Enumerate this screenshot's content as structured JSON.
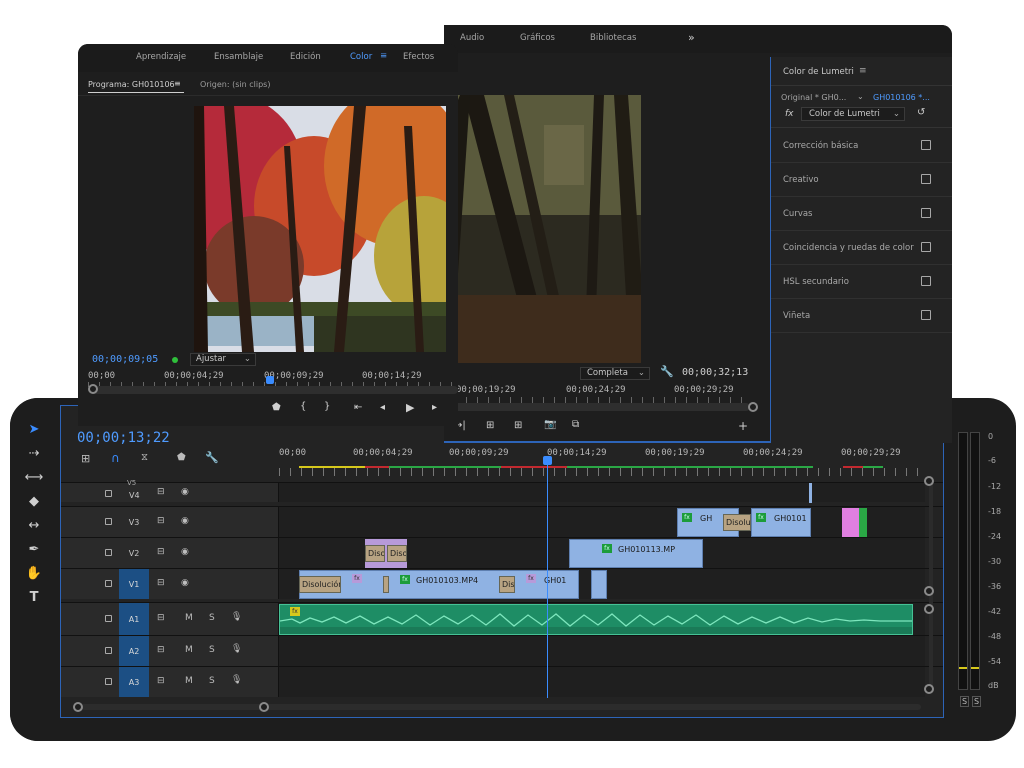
{
  "workspace_tabs": [
    "Aprendizaje",
    "Ensamblaje",
    "Edición",
    "Color",
    "Efectos",
    "Audio",
    "Gráficos",
    "Bibliotecas"
  ],
  "workspace_active": "Color",
  "overflow_label": "»",
  "program": {
    "tab_program": "Programa: GH010106",
    "tab_source": "Origen: (sin clips)",
    "timecode": "00;00;09;05",
    "fit_label": "Ajustar",
    "ruler_labels": [
      "00;00",
      "00;00;04;29",
      "00;00;09;29",
      "00;00;14;29"
    ]
  },
  "second_monitor": {
    "quality_label": "Completa",
    "timecode": "00;00;32;13",
    "ruler_labels": [
      "00;00;19;29",
      "00;00;24;29",
      "00;00;29;29"
    ]
  },
  "lumetri": {
    "title": "Color de Lumetri",
    "source_label": "Original * GH0...",
    "clip_label": "GH010106 *...",
    "effect_label": "Color de Lumetri",
    "fx_label": "fx",
    "sections": [
      "Corrección básica",
      "Creativo",
      "Curvas",
      "Coincidencia y ruedas de color",
      "HSL secundario",
      "Viñeta"
    ]
  },
  "timeline": {
    "timecode": "00;00;13;22",
    "ruler_labels": [
      "00;00",
      "00;00;04;29",
      "00;00;09;29",
      "00;00;14;29",
      "00;00;19;29",
      "00;00;24;29",
      "00;00;29;29"
    ],
    "video_tracks": [
      "V5",
      "V4",
      "V3",
      "V2",
      "V1"
    ],
    "audio_tracks": [
      "A1",
      "A2",
      "A3"
    ],
    "track_m": "M",
    "track_s": "S",
    "clips": {
      "v3_a": "GH",
      "v3_dis": "Disolu",
      "v3_b": "GH0101",
      "v2_dis1": "Diso",
      "v2_dis2": "Diso",
      "v2_clip": "GH010113.MP",
      "v1_dis1": "Disolución",
      "v1_clip": "GH010103.MP4",
      "v1_dis2": "Dis",
      "v1_clip2": "GH01",
      "fx": "fx"
    }
  },
  "meter": {
    "db_labels": [
      "0",
      "-6",
      "-12",
      "-18",
      "-24",
      "-30",
      "-36",
      "-42",
      "-48",
      "-54",
      "dB"
    ],
    "solo": [
      "S",
      "S"
    ]
  },
  "colors": {
    "accent": "#3a8cff",
    "audio": "#1e8d65",
    "video_clip": "#8fb2e3",
    "v_track_on": "#1c4f84"
  }
}
